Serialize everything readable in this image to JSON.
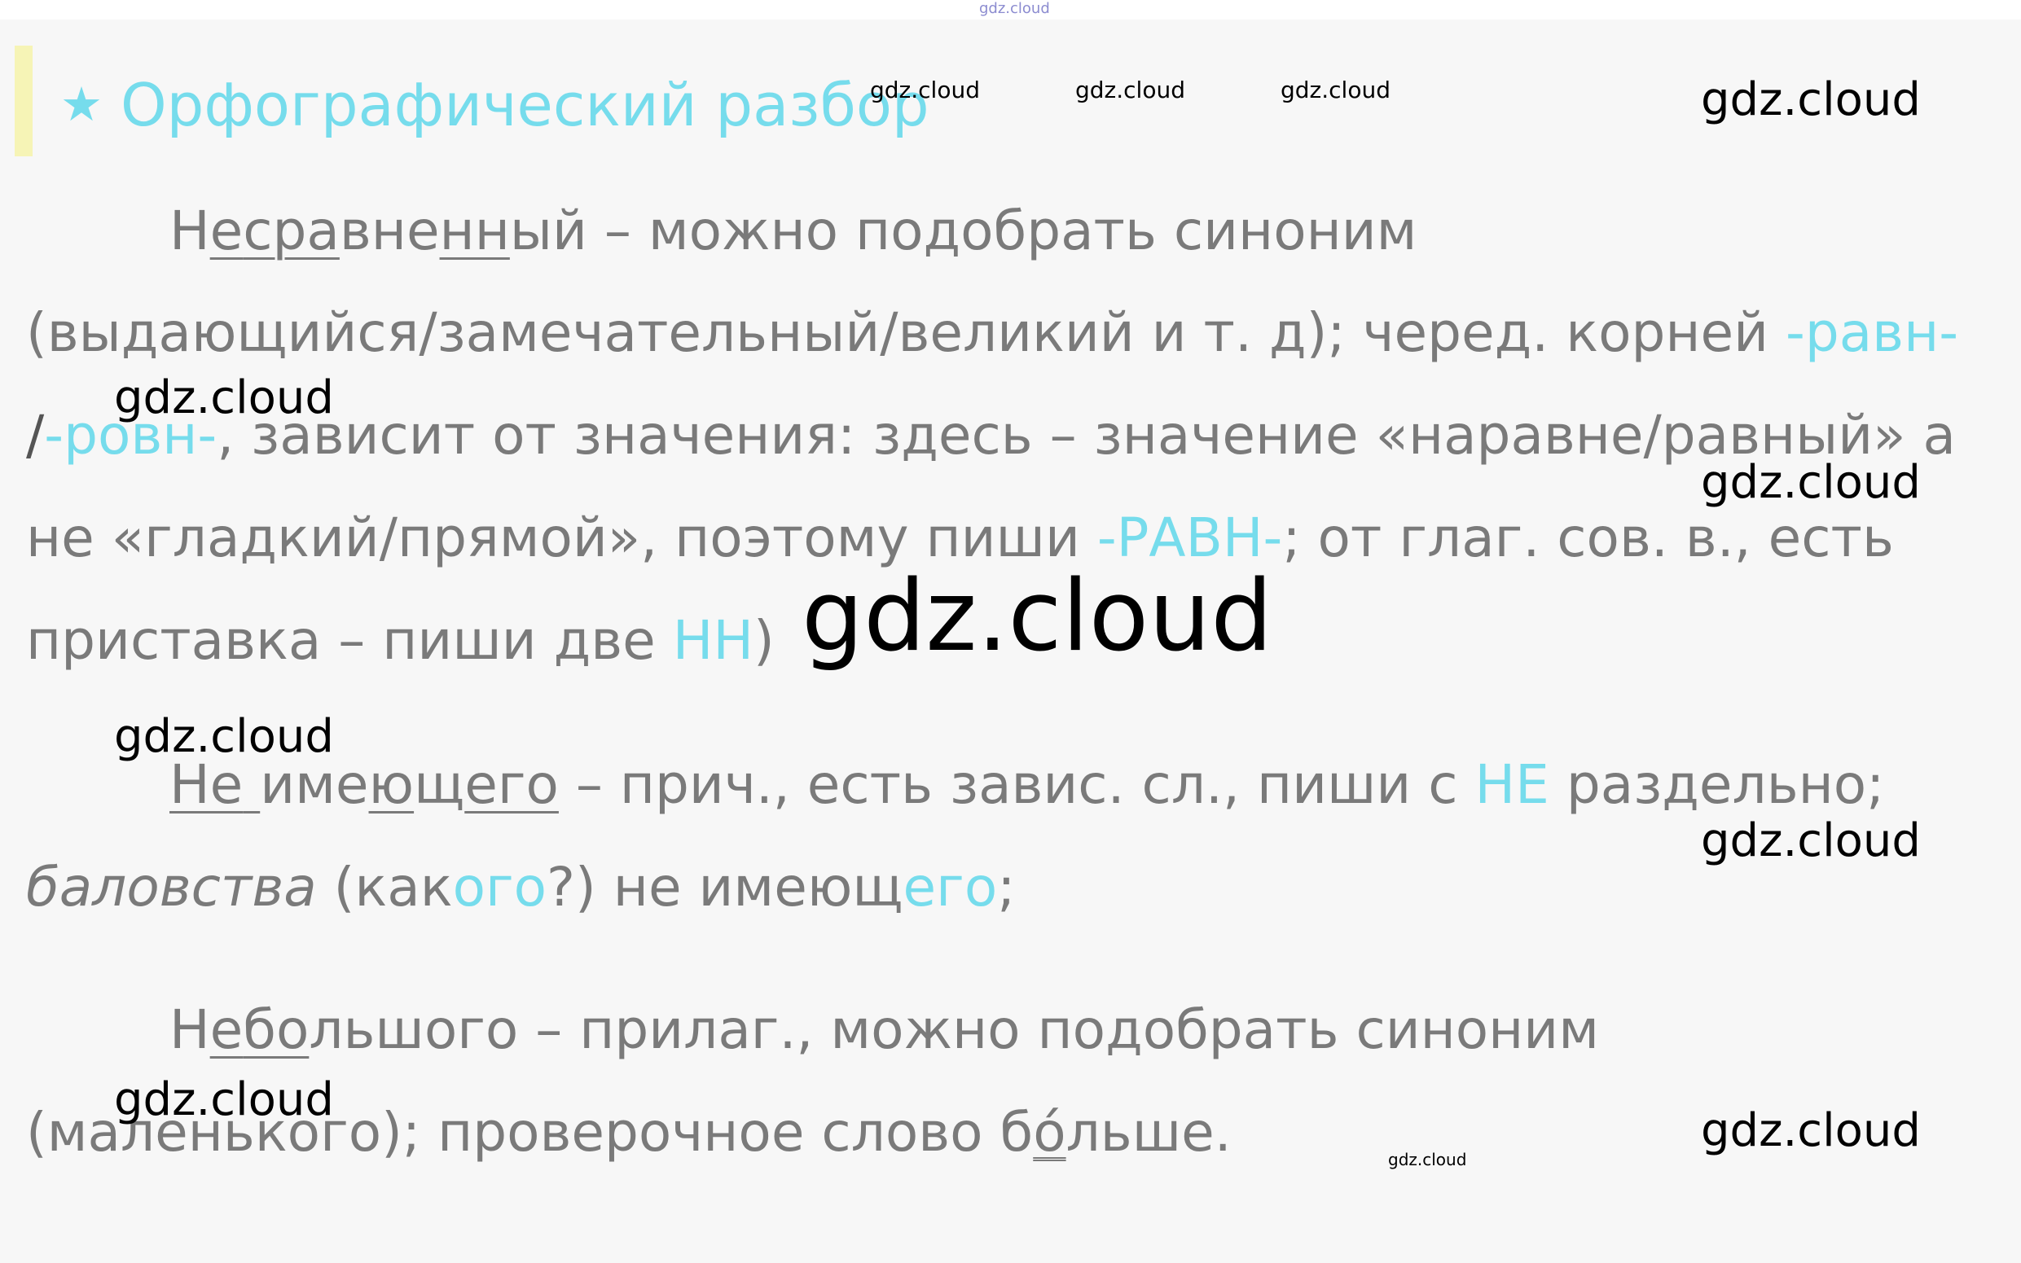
{
  "watermark": {
    "text": "gdz.cloud"
  },
  "header": {
    "star": "★",
    "title": "Орфографический разбор"
  },
  "para1": {
    "line1": {
      "a": "Н",
      "b": "е",
      "c": "сра",
      "d": "вне",
      "e": "нн",
      "f": "ый – можно подобрать синоним"
    },
    "line2": {
      "text": "(выдающийся/замечательный/великий и т. д); черед. корней ",
      "root1": "-равн-"
    },
    "line3": {
      "slash": "/",
      "root2": "-ровн-",
      "text": ", зависит от значения: здесь – значение «наравне/равный» а"
    },
    "line4": {
      "text": "не «гладкий/прямой», поэтому пиши ",
      "root": "-РАВН-",
      "rest": "; от глаг. сов. в., есть"
    },
    "line5": {
      "text": "приставка – пиши две ",
      "nn": "НН",
      "close": ")"
    }
  },
  "para2": {
    "line1": {
      "a": "Не",
      "b": " ",
      "c": "име",
      "d": "ю",
      "e": "щ",
      "f": "его",
      "text": " – прич., есть завис. сл., пиши с ",
      "ne": "НЕ",
      "rest": " раздельно;"
    },
    "line2": {
      "word": "баловства",
      "open": " (как",
      "end1": "ого",
      "mid": "?) не имеющ",
      "end2": "его",
      "close": ";"
    }
  },
  "para3": {
    "line1": {
      "a": "Н",
      "b": "е",
      "c": "бо",
      "d": "льшого – прилаг., можно подобрать синоним"
    },
    "line2": {
      "a": "(маленького); проверочное слово б",
      "b": "ó",
      "c": "льше."
    }
  }
}
